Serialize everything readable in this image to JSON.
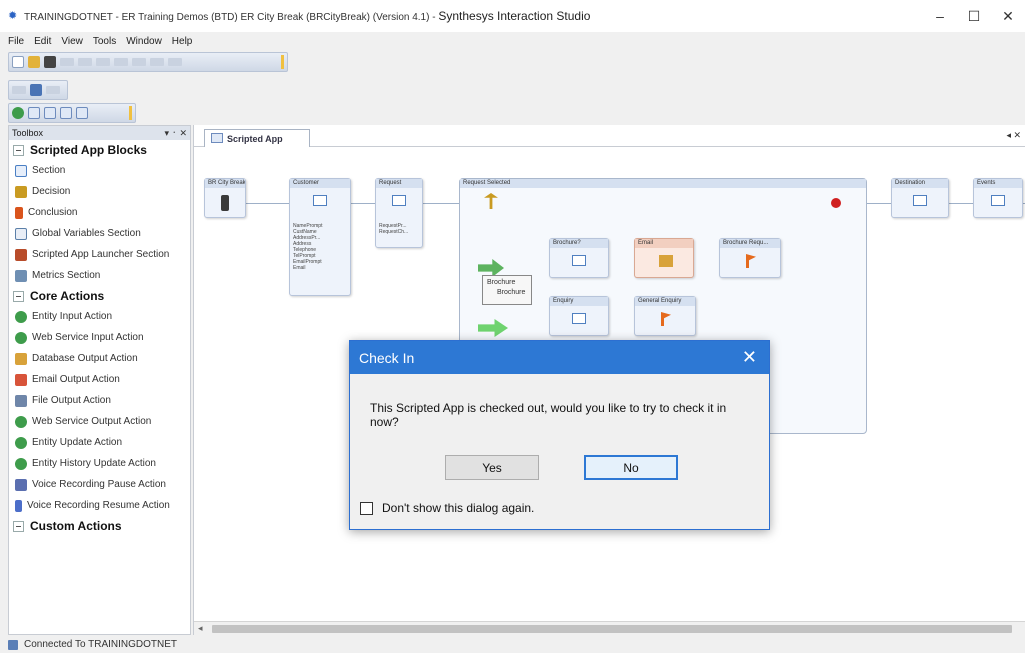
{
  "window": {
    "title_small": "TRAININGDOTNET - ER Training Demos (BTD) ER City Break (BRCityBreak) (Version 4.1) - ",
    "title_big": "Synthesys Interaction Studio",
    "minimize": "–",
    "maximize": "☐",
    "close": "✕"
  },
  "menu": [
    "File",
    "Edit",
    "View",
    "Tools",
    "Window",
    "Help"
  ],
  "toolbox": {
    "title": "Toolbox",
    "controls": "▾ ᛫ ✕",
    "categories": [
      {
        "label": "Scripted App Blocks",
        "items": [
          "Section",
          "Decision",
          "Conclusion",
          "Global Variables Section",
          "Scripted App Launcher Section",
          "Metrics Section"
        ]
      },
      {
        "label": "Core Actions",
        "items": [
          "Entity Input Action",
          "Web Service Input Action",
          "Database Output Action",
          "Email Output Action",
          "File Output Action",
          "Web Service Output Action",
          "Entity Update Action",
          "Entity History Update Action",
          "Voice Recording Pause Action",
          "Voice Recording Resume Action"
        ]
      },
      {
        "label": "Custom Actions",
        "items": []
      }
    ],
    "icon_colors": {
      "section": "#4a7fc4",
      "decision": "#c99b22",
      "conclusion": "#d9541c",
      "global": "#5b7fa8",
      "launcher": "#b84c2a",
      "metrics": "#6f8fb3",
      "action": "#3e9c4b",
      "database": "#d8a23a",
      "email": "#d8543a",
      "file": "#6f86a9",
      "voice_pause": "#5b6fb0",
      "voice_resume": "#4c6ec9"
    }
  },
  "document": {
    "tab": "Scripted App",
    "close": "◂ ✕",
    "nodes": {
      "n1": "BR City Break",
      "n2": "Customer",
      "n3": "Request",
      "group": "Request Selected",
      "brochure_q": "Brochure?",
      "email": "Email",
      "brochure_req": "Brochure Requ...",
      "enquiry": "Enquiry",
      "general_enquiry": "General Enquiry",
      "destination": "Destination",
      "events": "Events"
    },
    "customer_fields": [
      "NamePrompt",
      "CustName",
      "AddressPr...",
      "Address",
      "Telephone",
      "TelPrompt",
      "EmailPrompt",
      "Email"
    ],
    "request_fields": [
      "RequestPr...",
      "RequestCh..."
    ],
    "tooltip": [
      "Brochure",
      "Brochure"
    ]
  },
  "dialog": {
    "title": "Check In",
    "close": "✕",
    "message": "This Scripted App is checked out, would you like to try to check it in now?",
    "yes": "Yes",
    "no": "No",
    "dont_show": "Don't show this dialog again."
  },
  "status": {
    "text": "Connected To TRAININGDOTNET"
  }
}
